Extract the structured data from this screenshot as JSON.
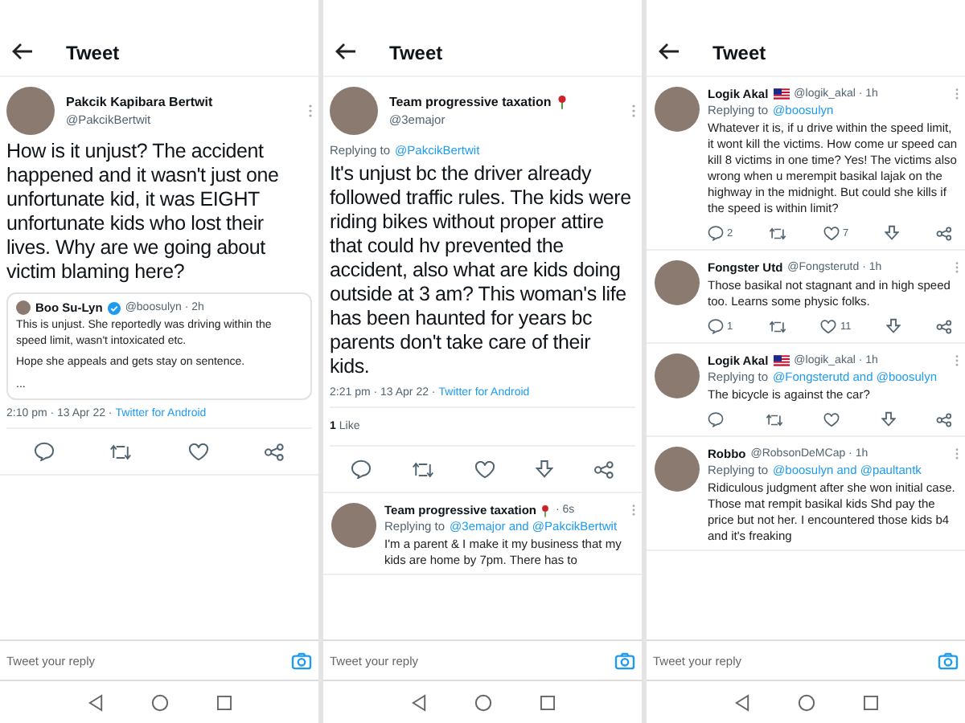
{
  "panels": [
    {
      "title": "Tweet",
      "reply_placeholder": "Tweet your reply",
      "tweets": [
        {
          "kind": "main",
          "name": "Pakcik Kapibara Bertwit",
          "handle": "@PakcikBertwit",
          "text": "How is it unjust? The accident happened and it wasn't just one unfortunate kid, it was EIGHT unfortunate kids who lost their lives. Why are we going about victim blaming here?",
          "quote": {
            "name": "Boo Su-Lyn",
            "verified": true,
            "handle": "@boosulyn · 2h",
            "paragraphs": [
              "This is unjust. She reportedly was driving within the speed limit, wasn't intoxicated etc.",
              "Hope she appeals and gets stay on sentence.",
              "..."
            ]
          },
          "timestamp": "2:10 pm · 13 Apr 22 ·",
          "source": "Twitter for Android",
          "actions": [
            {
              "kind": "reply"
            },
            {
              "kind": "retweet"
            },
            {
              "kind": "like"
            },
            {
              "kind": "share"
            }
          ]
        }
      ]
    },
    {
      "title": "Tweet",
      "reply_placeholder": "Tweet your reply",
      "tweets": [
        {
          "kind": "main",
          "name": "Team progressive taxation",
          "rose": true,
          "handle": "@3emajor",
          "replying_label": "Replying to",
          "replying_handles": "@PakcikBertwit",
          "text": "It's unjust bc the driver already followed traffic rules. The kids were riding bikes without proper attire that could hv prevented the accident, also what are kids doing outside at 3 am? This woman's life has been haunted for years bc parents don't take care of their kids.",
          "timestamp": "2:21 pm · 13 Apr 22 ·",
          "source": "Twitter for Android",
          "likes_count": "1",
          "likes_label": "Like",
          "actions": [
            {
              "kind": "reply"
            },
            {
              "kind": "retweet"
            },
            {
              "kind": "like"
            },
            {
              "kind": "save"
            },
            {
              "kind": "share"
            }
          ]
        },
        {
          "kind": "reply",
          "name": "Team progressive taxation",
          "rose": true,
          "handle": "· 6s",
          "replying_label": "Replying to",
          "replying_handles": "@3emajor and @PakcikBertwit",
          "text": "I'm a parent & I make it my business that my kids are home by 7pm. There has to"
        }
      ]
    },
    {
      "title": "Tweet",
      "reply_placeholder": "Tweet your reply",
      "tweets": [
        {
          "kind": "reply",
          "name": "Logik Akal",
          "flag": true,
          "handle": "@logik_akal · 1h",
          "replying_label": "Replying to",
          "replying_handles": "@boosulyn",
          "text": "Whatever it is, if u drive within the speed limit, it wont kill the victims. How come ur speed can kill 8 victims in one time? Yes! The victims also wrong when u merempit basikal lajak on the highway in the midnight. But could she kills if the speed is within limit?",
          "actions": [
            {
              "kind": "reply",
              "count": "2"
            },
            {
              "kind": "retweet"
            },
            {
              "kind": "like",
              "count": "7"
            },
            {
              "kind": "save"
            },
            {
              "kind": "share"
            }
          ]
        },
        {
          "kind": "reply",
          "name": "Fongster Utd",
          "handle": "@Fongsterutd · 1h",
          "text": "Those basikal not stagnant and in high speed too. Learns some physic folks.",
          "actions": [
            {
              "kind": "reply",
              "count": "1"
            },
            {
              "kind": "retweet"
            },
            {
              "kind": "like",
              "count": "11"
            },
            {
              "kind": "save"
            },
            {
              "kind": "share"
            }
          ]
        },
        {
          "kind": "reply",
          "name": "Logik Akal",
          "flag": true,
          "handle": "@logik_akal · 1h",
          "replying_label": "Replying to",
          "replying_handles": "@Fongsterutd and @boosulyn",
          "text": "The bicycle is against the car?",
          "actions": [
            {
              "kind": "reply"
            },
            {
              "kind": "retweet"
            },
            {
              "kind": "like"
            },
            {
              "kind": "save"
            },
            {
              "kind": "share"
            }
          ]
        },
        {
          "kind": "reply",
          "name": "Robbo",
          "handle": "@RobsonDeMCap · 1h",
          "replying_label": "Replying to",
          "replying_handles": "@boosulyn and @paultantk",
          "text": "Ridiculous judgment after she won initial case. Those mat rempit basikal kids Shd pay the price but not her. I encountered those kids b4 and it's freaking"
        }
      ]
    }
  ]
}
